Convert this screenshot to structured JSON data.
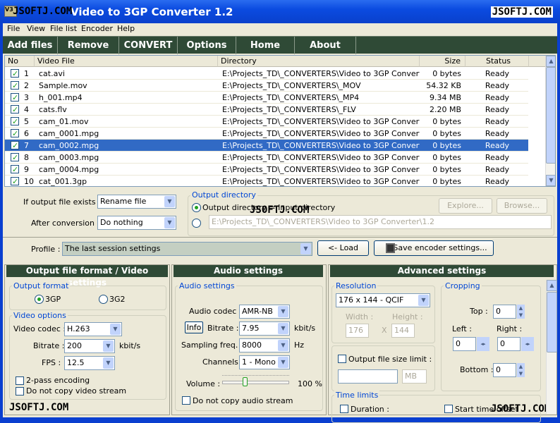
{
  "window": {
    "title": "Video to 3GP Converter 1.2",
    "watermark": "JSOFTJ.COM",
    "icon": "app-icon-v3gp"
  },
  "menu": [
    "File",
    "View",
    "File list",
    "Encoder",
    "Help"
  ],
  "toolbar": [
    "Add files",
    "Remove",
    "CONVERT",
    "Options",
    "Home page",
    "About"
  ],
  "table": {
    "columns": [
      "No",
      "Video File",
      "Directory",
      "Size",
      "Status"
    ],
    "rows": [
      {
        "checked": true,
        "no": "1",
        "file": "cat.avi",
        "dir": "E:\\Projects_TD\\_CONVERTERS\\Video to 3GP Converte...",
        "size": "0 bytes",
        "status": "Ready"
      },
      {
        "checked": true,
        "no": "2",
        "file": "Sample.mov",
        "dir": "E:\\Projects_TD\\_CONVERTERS\\_MOV",
        "size": "54.32 KB",
        "status": "Ready"
      },
      {
        "checked": true,
        "no": "3",
        "file": "h_001.mp4",
        "dir": "E:\\Projects_TD\\_CONVERTERS\\_MP4",
        "size": "9.34 MB",
        "status": "Ready"
      },
      {
        "checked": true,
        "no": "4",
        "file": "cats.flv",
        "dir": "E:\\Projects_TD\\_CONVERTERS\\_FLV",
        "size": "2.20 MB",
        "status": "Ready"
      },
      {
        "checked": true,
        "no": "5",
        "file": "cam_01.mov",
        "dir": "E:\\Projects_TD\\_CONVERTERS\\Video to 3GP Converte...",
        "size": "0 bytes",
        "status": "Ready"
      },
      {
        "checked": true,
        "no": "6",
        "file": "cam_0001.mpg",
        "dir": "E:\\Projects_TD\\_CONVERTERS\\Video to 3GP Converte...",
        "size": "0 bytes",
        "status": "Ready"
      },
      {
        "checked": true,
        "no": "7",
        "file": "cam_0002.mpg",
        "dir": "E:\\Projects_TD\\_CONVERTERS\\Video to 3GP Converte...",
        "size": "0 bytes",
        "status": "Ready",
        "selected": true
      },
      {
        "checked": true,
        "no": "8",
        "file": "cam_0003.mpg",
        "dir": "E:\\Projects_TD\\_CONVERTERS\\Video to 3GP Converte...",
        "size": "0 bytes",
        "status": "Ready"
      },
      {
        "checked": true,
        "no": "9",
        "file": "cam_0004.mpg",
        "dir": "E:\\Projects_TD\\_CONVERTERS\\Video to 3GP Converte...",
        "size": "0 bytes",
        "status": "Ready"
      },
      {
        "checked": true,
        "no": "10",
        "file": "cat_001.3gp",
        "dir": "E:\\Projects_TD\\_CONVERTERS\\Video to 3GP Converte...",
        "size": "0 bytes",
        "status": "Ready"
      }
    ]
  },
  "options": {
    "if_exists_label": "If output file exists :",
    "if_exists_value": "Rename file",
    "after_label": "After conversion :",
    "after_value": "Do nothing",
    "outdir_group": "Output directory",
    "outdir_radio1": "Output directory = Input directory",
    "outdir_path": "E:\\Projects_TD\\_CONVERTERS\\Video to 3GP Converter\\1.2",
    "explore": "Explore...",
    "browse": "Browse..."
  },
  "profile": {
    "label": "Profile :",
    "value": "The last session settings",
    "load": "<- Load",
    "save": "Save encoder settings..."
  },
  "video": {
    "header": "Output file format / Video settings",
    "format_group": "Output format",
    "fmt1": "3GP",
    "fmt2": "3G2",
    "options_group": "Video options",
    "codec_label": "Video codec :",
    "codec": "H.263",
    "bitrate_label": "Bitrate :",
    "bitrate": "200",
    "bitrate_unit": "kbit/s",
    "fps_label": "FPS :",
    "fps": "12.5",
    "twopass": "2-pass encoding",
    "nocopy": "Do not copy video stream"
  },
  "audio": {
    "header": "Audio settings",
    "group": "Audio settings",
    "codec_label": "Audio codec :",
    "codec": "AMR-NB",
    "info": "Info",
    "bitrate_label": "Bitrate :",
    "bitrate": "7.95",
    "bitrate_unit": "kbit/s",
    "freq_label": "Sampling freq. :",
    "freq": "8000",
    "freq_unit": "Hz",
    "channels_label": "Channels :",
    "channels": "1 - Mono",
    "volume_label": "Volume :",
    "volume": "100 %",
    "volume_percent": 100,
    "nocopy": "Do not copy audio stream"
  },
  "advanced": {
    "header": "Advanced settings",
    "res_group": "Resolution",
    "res": "176 x 144 - QCIF",
    "width_label": "Width :",
    "height_label": "Height :",
    "width": "176",
    "height": "144",
    "x": "X",
    "sizelimit": "Output file size limit :",
    "size_unit": "MB",
    "crop_group": "Cropping",
    "top_label": "Top :",
    "top": "0",
    "left_label": "Left :",
    "left": "0",
    "right_label": "Right :",
    "right": "0",
    "bottom_label": "Bottom :",
    "bottom": "0",
    "time_group": "Time limits",
    "duration": "Duration :",
    "start": "Start time offset"
  }
}
